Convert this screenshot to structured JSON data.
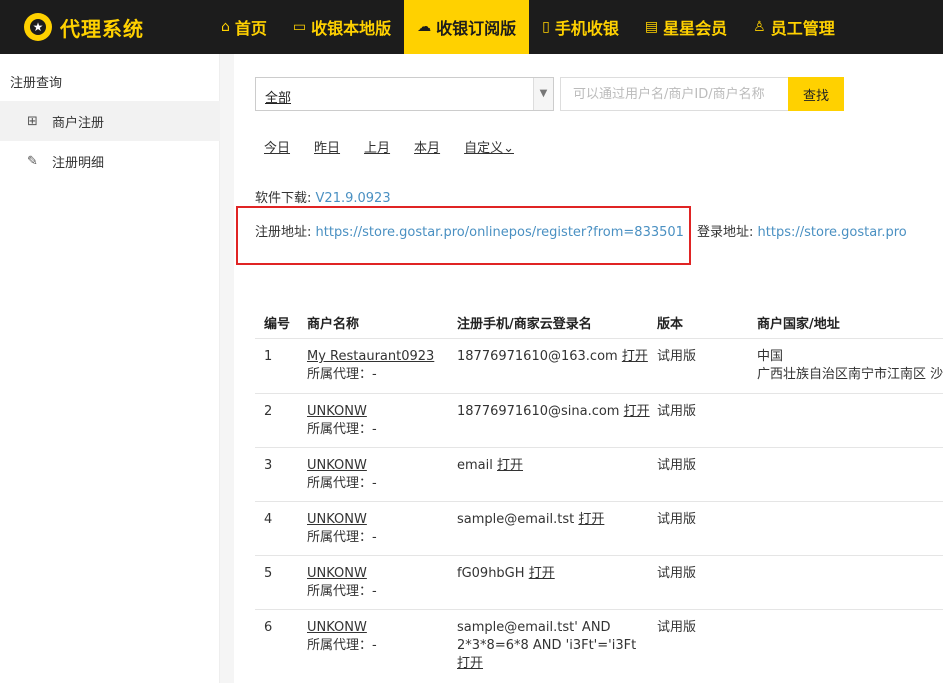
{
  "app": {
    "logo_glyph": "★",
    "title": "代理系统"
  },
  "nav": [
    {
      "icon": "⌂",
      "label": "首页"
    },
    {
      "icon": "▭",
      "label": "收银本地版"
    },
    {
      "icon": "☁",
      "label": "收银订阅版",
      "active": true
    },
    {
      "icon": "▯",
      "label": "手机收银"
    },
    {
      "icon": "▤",
      "label": "星星会员"
    },
    {
      "icon": "♙",
      "label": "员工管理"
    }
  ],
  "sidebar": {
    "group": "注册查询",
    "items": [
      {
        "icon": "⊞",
        "label": "商户注册",
        "active": true
      },
      {
        "icon": "✎",
        "label": "注册明细"
      }
    ]
  },
  "filters": {
    "select_value": "全部",
    "search_placeholder": "可以通过用户名/商户ID/商户名称",
    "search_button": "查找",
    "date_tabs": [
      "今日",
      "昨日",
      "上月",
      "本月",
      "自定义"
    ]
  },
  "info": {
    "download_label": "软件下载:",
    "download_version": "V21.9.0923",
    "register_label": "注册地址:",
    "register_url": "https://store.gostar.pro/onlinepos/register?from=833501",
    "login_label": "登录地址:",
    "login_url": "https://store.gostar.pro"
  },
  "table": {
    "headers": [
      "编号",
      "商户名称",
      "注册手机/商家云登录名",
      "版本",
      "商户国家/地址"
    ],
    "open_label": "打开",
    "agent_label": "所属代理：-",
    "rows": [
      {
        "no": "1",
        "name": "My Restaurant0923",
        "login_lines": [
          "18776971610@163.com"
        ],
        "version": "试用版",
        "country": "中国",
        "address": "广西壮族自治区南宁市江南区 沙"
      },
      {
        "no": "2",
        "name": "UNKONW",
        "login_lines": [
          "18776971610@sina.com"
        ],
        "version": "试用版",
        "country": "",
        "address": ""
      },
      {
        "no": "3",
        "name": "UNKONW",
        "login_lines": [
          "email"
        ],
        "version": "试用版",
        "country": "",
        "address": ""
      },
      {
        "no": "4",
        "name": "UNKONW",
        "login_lines": [
          "sample@email.tst"
        ],
        "version": "试用版",
        "country": "",
        "address": ""
      },
      {
        "no": "5",
        "name": "UNKONW",
        "login_lines": [
          "fG09hbGH"
        ],
        "version": "试用版",
        "country": "",
        "address": ""
      },
      {
        "no": "6",
        "name": "UNKONW",
        "login_lines": [
          "sample@email.tst' AND",
          "2*3*8=6*8 AND 'i3Ft'='i3Ft"
        ],
        "version": "试用版",
        "country": "",
        "address": ""
      }
    ]
  },
  "colors": {
    "topbar": "#1c1c1c",
    "accent": "#ffd100",
    "link": "#4a90c2",
    "highlight_box": "#e02424"
  }
}
